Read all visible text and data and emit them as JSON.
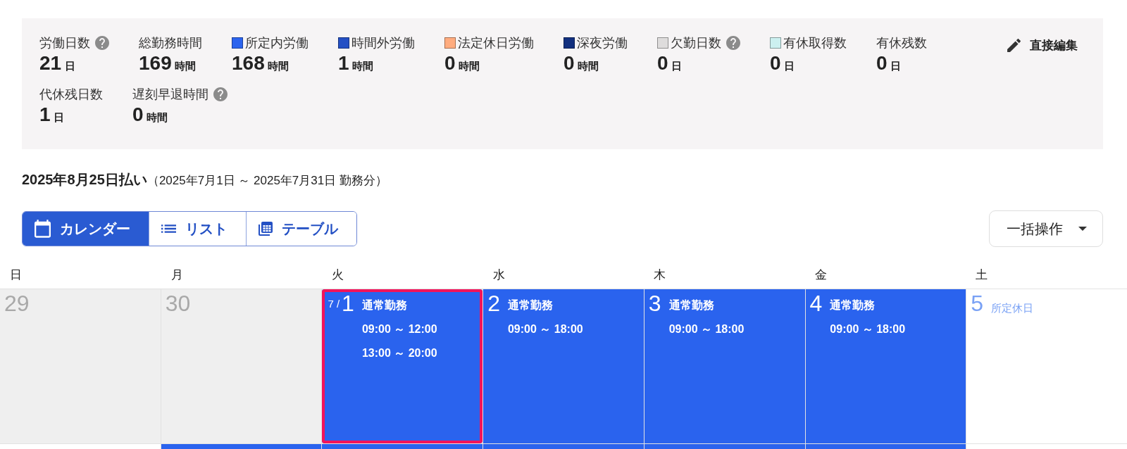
{
  "summary": {
    "rows": [
      {
        "stats": [
          {
            "label": "労働日数",
            "help": true,
            "value": "21",
            "unit": "日"
          },
          {
            "label": "総勤務時間",
            "help": false,
            "value": "169",
            "unit": "時間"
          },
          {
            "label": "所定内労働",
            "color": "#2c64ee",
            "help": false,
            "value": "168",
            "unit": "時間"
          },
          {
            "label": "時間外労働",
            "color": "#2450c4",
            "help": false,
            "value": "1",
            "unit": "時間"
          },
          {
            "label": "法定休日労働",
            "color": "#ffac7f",
            "help": false,
            "value": "0",
            "unit": "時間"
          },
          {
            "label": "深夜労働",
            "color": "#12307f",
            "help": false,
            "value": "0",
            "unit": "時間"
          },
          {
            "label": "欠勤日数",
            "color": "#dedcdc",
            "help": true,
            "value": "0",
            "unit": "日"
          },
          {
            "label": "有休取得数",
            "color": "#ccf0f0",
            "help": false,
            "value": "0",
            "unit": "日"
          },
          {
            "label": "有休残数",
            "help": false,
            "value": "0",
            "unit": "日"
          }
        ]
      },
      {
        "stats": [
          {
            "label": "代休残日数",
            "help": false,
            "value": "1",
            "unit": "日"
          },
          {
            "label": "遅刻早退時間",
            "help": true,
            "value": "0",
            "unit": "時間"
          }
        ]
      }
    ],
    "edit_button": {
      "label": "直接編集"
    }
  },
  "pay_period": {
    "title": "2025年8月25日払い",
    "range": "（2025年7月1日 ～ 2025年7月31日 勤務分）"
  },
  "view_tabs": [
    {
      "label": "カレンダー",
      "selected": true
    },
    {
      "label": "リスト",
      "selected": false
    },
    {
      "label": "テーブル",
      "selected": false
    }
  ],
  "bulk_action_button": {
    "label": "一括操作"
  },
  "calendar": {
    "weekdays": [
      "日",
      "月",
      "火",
      "水",
      "木",
      "金",
      "土"
    ],
    "weeks": [
      {
        "days": [
          {
            "kind": "outside",
            "day": "29",
            "selected": false
          },
          {
            "kind": "outside",
            "day": "30",
            "selected": false
          },
          {
            "kind": "work",
            "month": "7 /",
            "day": "1",
            "shift": "通常勤務",
            "times": [
              "09:00 ～ 12:00",
              "13:00 ～ 20:00"
            ],
            "selected": true
          },
          {
            "kind": "work",
            "day": "2",
            "shift": "通常勤務",
            "times": [
              "09:00 ～ 18:00"
            ],
            "selected": false
          },
          {
            "kind": "work",
            "day": "3",
            "shift": "通常勤務",
            "times": [
              "09:00 ～ 18:00"
            ],
            "selected": false
          },
          {
            "kind": "work",
            "day": "4",
            "shift": "通常勤務",
            "times": [
              "09:00 ～ 18:00"
            ],
            "selected": false
          },
          {
            "kind": "holiday",
            "day": "5",
            "shift": "所定休日",
            "selected": false
          }
        ]
      },
      {
        "days": [
          {
            "kind": "holiday",
            "selected": false
          },
          {
            "kind": "work",
            "selected": false
          },
          {
            "kind": "work",
            "selected": false
          },
          {
            "kind": "work",
            "selected": false
          },
          {
            "kind": "work",
            "selected": false
          },
          {
            "kind": "work",
            "selected": false
          },
          {
            "kind": "holiday",
            "selected": false
          }
        ]
      }
    ]
  }
}
